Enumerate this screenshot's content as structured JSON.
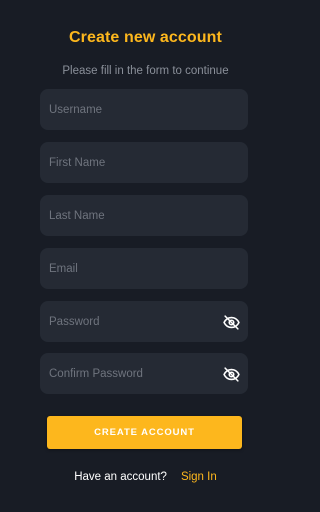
{
  "page": {
    "title": "Create new account",
    "subtitle": "Please fill in the form to continue"
  },
  "form": {
    "username": {
      "placeholder": "Username",
      "value": ""
    },
    "first_name": {
      "placeholder": "First Name",
      "value": ""
    },
    "last_name": {
      "placeholder": "Last Name",
      "value": ""
    },
    "email": {
      "placeholder": "Email",
      "value": ""
    },
    "password": {
      "placeholder": "Password",
      "value": "",
      "toggle_icon": "eye-off-icon"
    },
    "confirm_password": {
      "placeholder": "Confirm Password",
      "value": "",
      "toggle_icon": "eye-off-icon"
    }
  },
  "actions": {
    "submit_label": "CREATE ACCOUNT"
  },
  "footer": {
    "question": "Have an account?",
    "link_label": "Sign In"
  },
  "colors": {
    "background": "#181c25",
    "field_background": "#252a34",
    "accent": "#fdb71d",
    "placeholder": "#6f747e",
    "subtitle": "#8a8f99"
  }
}
